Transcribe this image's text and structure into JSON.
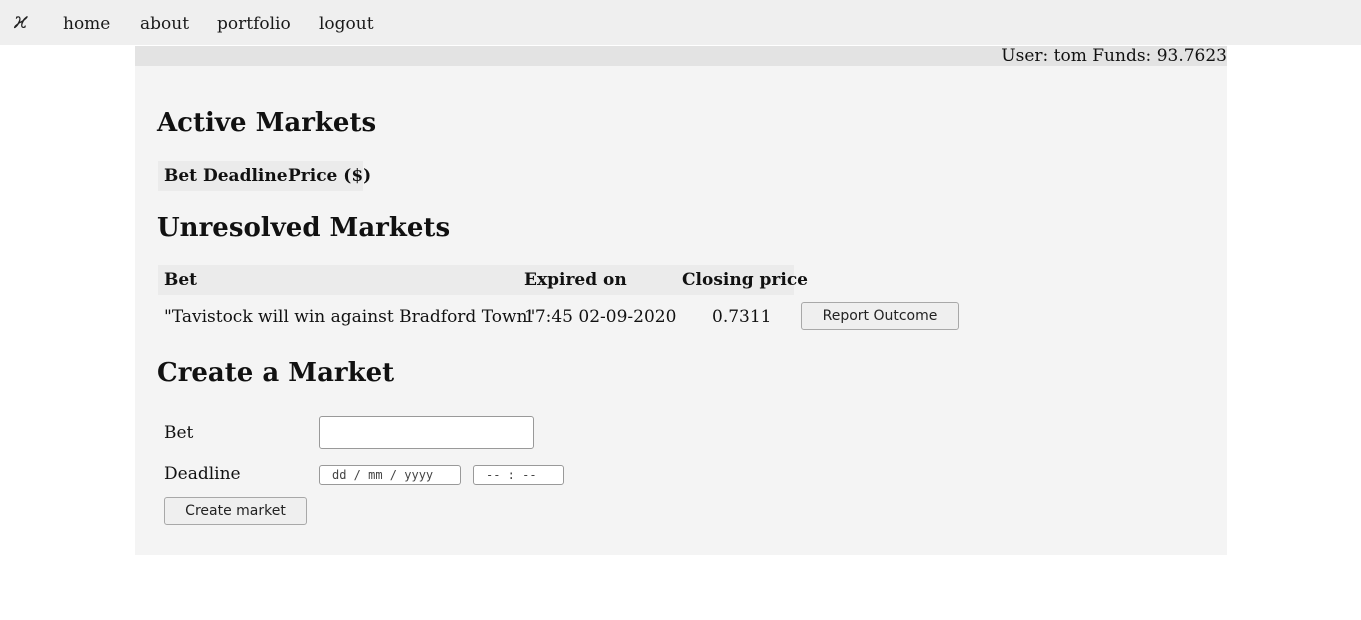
{
  "nav": {
    "logo": "ϰ",
    "links": [
      "home",
      "about",
      "portfolio",
      "logout"
    ]
  },
  "user_bar": {
    "text": "User: tom Funds: 93.7623"
  },
  "active_markets": {
    "title": "Active Markets",
    "headers": [
      "Bet",
      "Deadline",
      "Price ($)"
    ]
  },
  "unresolved_markets": {
    "title": "Unresolved Markets",
    "headers": [
      "Bet",
      "Expired on",
      "Closing price"
    ],
    "rows": [
      {
        "bet": "\"Tavistock will win against Bradford Town\"",
        "expired_on": "17:45 02-09-2020",
        "closing_price": "0.7311",
        "action": "Report Outcome"
      }
    ]
  },
  "create_market": {
    "title": "Create a Market",
    "bet_label": "Bet",
    "bet_value": "",
    "deadline_label": "Deadline",
    "date_placeholder": "dd / mm / yyyy",
    "time_placeholder": "-- : --",
    "submit_label": "Create market"
  },
  "colors": {
    "nav_bg": "#efefef",
    "container_bg": "#f4f4f4",
    "userbar_bg": "#e3e3e3",
    "header_cell_bg": "#ebebeb"
  }
}
